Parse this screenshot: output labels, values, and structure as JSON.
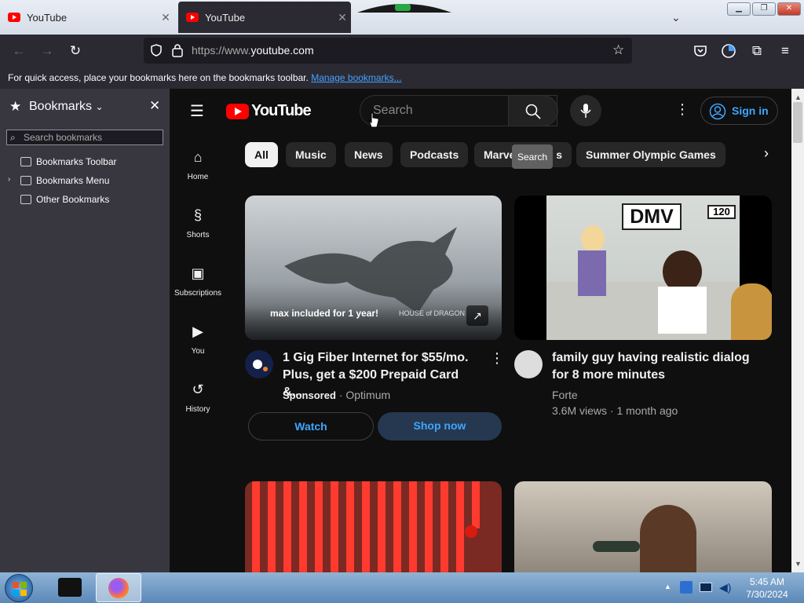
{
  "browser": {
    "tabs": [
      {
        "title": "YouTube"
      },
      {
        "title": "YouTube"
      }
    ],
    "url": {
      "prefix": "https://www.",
      "domain": "youtube.com"
    },
    "bookmarks_bar": {
      "text": "For quick access, place your bookmarks here on the bookmarks toolbar.",
      "link": "Manage bookmarks..."
    }
  },
  "sidebar": {
    "title": "Bookmarks",
    "search_placeholder": "Search bookmarks",
    "items": [
      {
        "label": "Bookmarks Toolbar"
      },
      {
        "label": "Bookmarks Menu"
      },
      {
        "label": "Other Bookmarks"
      }
    ]
  },
  "youtube": {
    "logo": "YouTube",
    "search_placeholder": "Search",
    "search_tooltip": "Search",
    "sign_in": "Sign in",
    "nav": [
      {
        "label": "Home"
      },
      {
        "label": "Shorts"
      },
      {
        "label": "Subscriptions"
      },
      {
        "label": "You"
      },
      {
        "label": "History"
      }
    ],
    "chips": [
      "All",
      "Music",
      "News",
      "Podcasts",
      "Marve",
      "s",
      "Summer Olympic Games"
    ],
    "videos": [
      {
        "title_line1": "1 Gig Fiber Internet for $55/mo.",
        "title_line2": "Plus, get a $200 Prepaid Card &...",
        "sponsored": "Sponsored",
        "dot": "·",
        "channel": "Optimum",
        "thumb_text": "max included for 1 year!",
        "thumb_brand": "HOUSE of DRAGON",
        "btn_watch": "Watch",
        "btn_shop": "Shop now"
      },
      {
        "title_line1": "family guy having realistic dialog",
        "title_line2": "for 8 more minutes",
        "channel": "Forte",
        "meta": "3.6M views · 1 month ago",
        "sign_dmv": "DMV",
        "sign_120": "120"
      }
    ]
  },
  "taskbar": {
    "time": "5:45 AM",
    "date": "7/30/2024"
  },
  "colors": {
    "accent": "#3ea6ff",
    "yt_red": "#ff0000",
    "bg": "#0f0f0f"
  }
}
